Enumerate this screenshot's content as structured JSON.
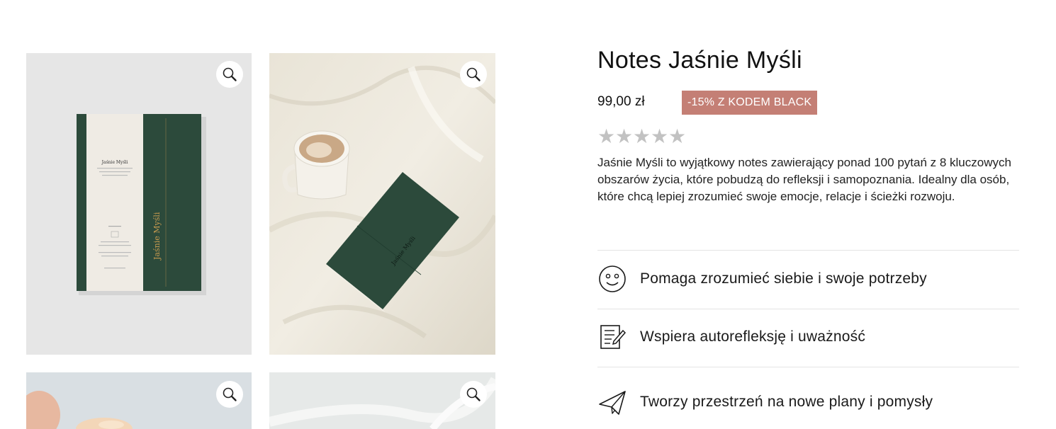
{
  "gallery": {
    "zoom_icon": "magnifier-icon",
    "tiles": [
      "notebook-cover-mockup",
      "notebook-on-bed-with-coffee",
      "hand-holding-item",
      "fabric-photo"
    ],
    "cover_title": "Jaśnie Myśli"
  },
  "product": {
    "title": "Notes Jaśnie Myśli",
    "price": "99,00 zł",
    "promo_badge": "-15% Z KODEM BLACK",
    "rating_stars": 5,
    "rating_filled": 0,
    "description": "Jaśnie Myśli to wyjątkowy notes zawierający ponad 100 pytań z 8 kluczowych obszarów życia, które pobudzą do refleksji i samopoznania. Idealny dla osób, które chcą lepiej zrozumieć swoje emocje, relacje i ścieżki rozwoju."
  },
  "features": [
    {
      "icon": "smiley-icon",
      "label": "Pomaga zrozumieć siebie i swoje potrzeby"
    },
    {
      "icon": "notepad-pen-icon",
      "label": "Wspiera autorefleksję i uważność"
    },
    {
      "icon": "paper-plane-icon",
      "label": "Tworzy przestrzeń na nowe plany i pomysły"
    }
  ],
  "colors": {
    "promo_bg": "#c47f75",
    "star_empty": "#c2c2c2",
    "notebook_green": "#2c4a3b"
  }
}
